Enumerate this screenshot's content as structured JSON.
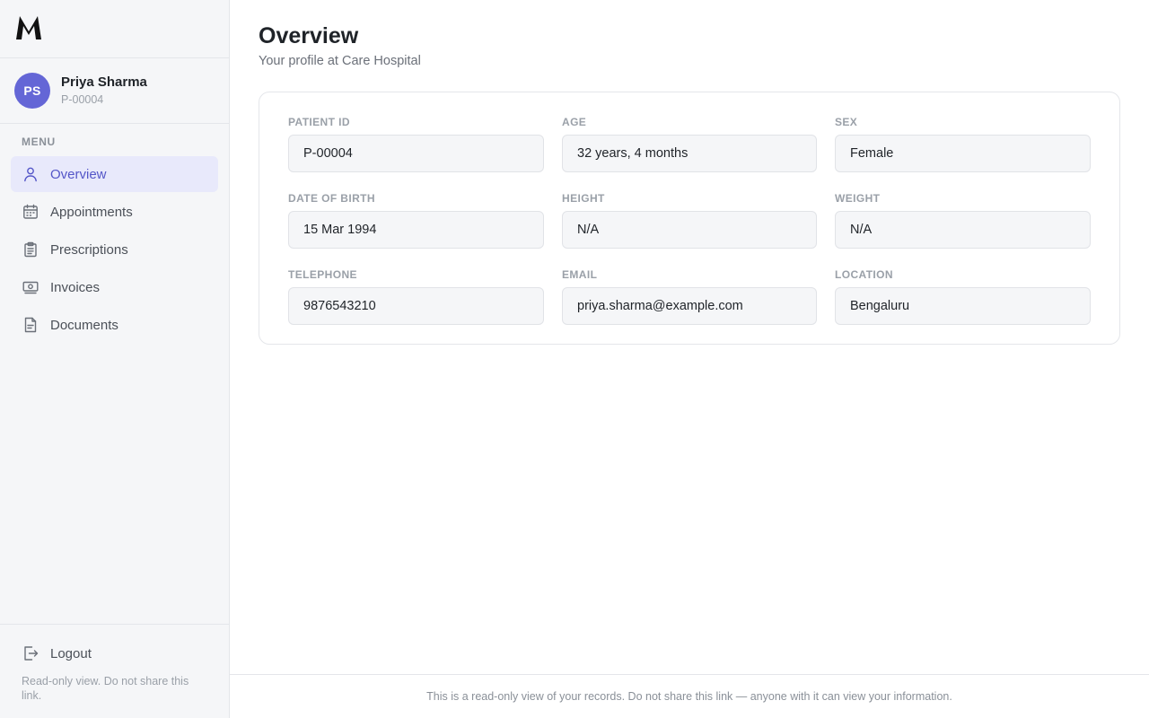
{
  "brand": {
    "logo_icon": "brand-m-logo"
  },
  "user": {
    "initials": "PS",
    "name": "Priya Sharma",
    "id": "P-00004",
    "avatar_color": "#6466d6"
  },
  "sidebar": {
    "menu_label": "MENU",
    "items": [
      {
        "label": "Overview",
        "icon": "user-icon",
        "active": true
      },
      {
        "label": "Appointments",
        "icon": "calendar-icon",
        "active": false
      },
      {
        "label": "Prescriptions",
        "icon": "clipboard-icon",
        "active": false
      },
      {
        "label": "Invoices",
        "icon": "banknote-icon",
        "active": false
      },
      {
        "label": "Documents",
        "icon": "document-icon",
        "active": false
      }
    ],
    "logout_label": "Logout",
    "note": "Read-only view. Do not share this link."
  },
  "main": {
    "title": "Overview",
    "subtitle": "Your profile at Care Hospital",
    "fields": [
      {
        "label": "PATIENT ID",
        "value": "P-00004"
      },
      {
        "label": "AGE",
        "value": "32 years, 4 months"
      },
      {
        "label": "SEX",
        "value": "Female"
      },
      {
        "label": "DATE OF BIRTH",
        "value": "15 Mar 1994"
      },
      {
        "label": "HEIGHT",
        "value": "N/A"
      },
      {
        "label": "WEIGHT",
        "value": "N/A"
      },
      {
        "label": "TELEPHONE",
        "value": "9876543210"
      },
      {
        "label": "EMAIL",
        "value": "priya.sharma@example.com"
      },
      {
        "label": "LOCATION",
        "value": "Bengaluru"
      }
    ]
  },
  "footer": {
    "text": "This is a read-only view of your records. Do not share this link — anyone with it can view your information."
  },
  "colors": {
    "accent": "#5456c8",
    "active_bg": "#e8e9fb",
    "sidebar_bg": "#f5f6f8"
  }
}
